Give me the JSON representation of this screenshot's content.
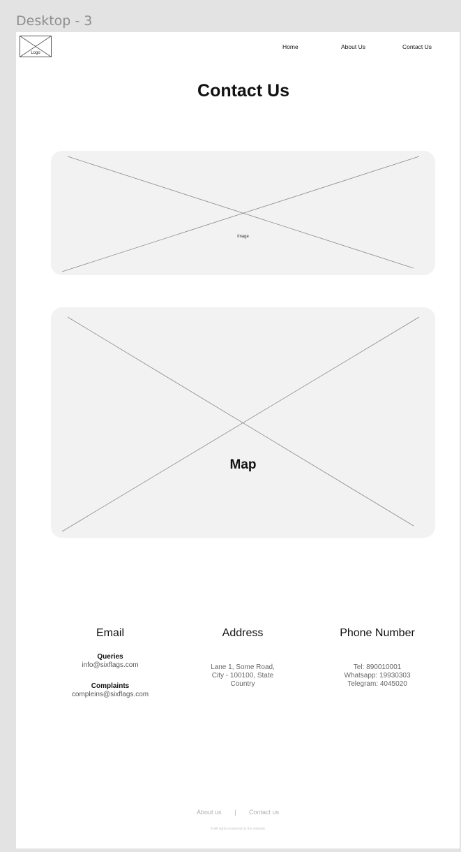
{
  "window": {
    "frame_title": "Desktop - 3"
  },
  "header": {
    "logo_label": "Logo",
    "nav": {
      "home": "Home",
      "about": "About Us",
      "contact": "Contact Us"
    }
  },
  "main": {
    "title": "Contact Us",
    "image_placeholder_label": "Image",
    "map_label": "Map"
  },
  "contact": {
    "email": {
      "heading": "Email",
      "queries_label": "Queries",
      "queries_value": "info@sixflags.com",
      "complaints_label": "Complaints",
      "complaints_value": "compleins@sixflags.com"
    },
    "address": {
      "heading": "Address",
      "lines": [
        "Lane 1, Some Road,",
        "City - 100100, State",
        "Country"
      ]
    },
    "phone": {
      "heading": "Phone Number",
      "lines": [
        "Tel: 890010001",
        "Whatsapp: 19930303",
        "Telegram: 4045020"
      ]
    }
  },
  "footer": {
    "links": {
      "about": "About us",
      "separator": "|",
      "contact": "Contact us"
    },
    "copyright": "© All rights reserved by the website"
  }
}
